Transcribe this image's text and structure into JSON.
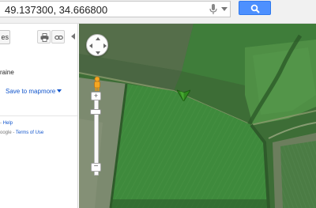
{
  "search": {
    "value": "49.137300, 34.666800"
  },
  "panel": {
    "tab_fragment": "es",
    "address_fragment": "raine",
    "save_to_map": "Save to map",
    "more": "more",
    "footer_line1_sep": "-",
    "footer_line1_link": "Help",
    "footer_line2_prefix": "oogle",
    "footer_line2_sep": "-",
    "footer_line2_link": "Terms of Use"
  },
  "map": {
    "zoom_in_symbol": "+",
    "zoom_out_symbol": "−",
    "map_type": "satellite",
    "marker_color": "#2f8a1e"
  },
  "colors": {
    "search_button": "#4d90fe",
    "link": "#1155cc"
  }
}
